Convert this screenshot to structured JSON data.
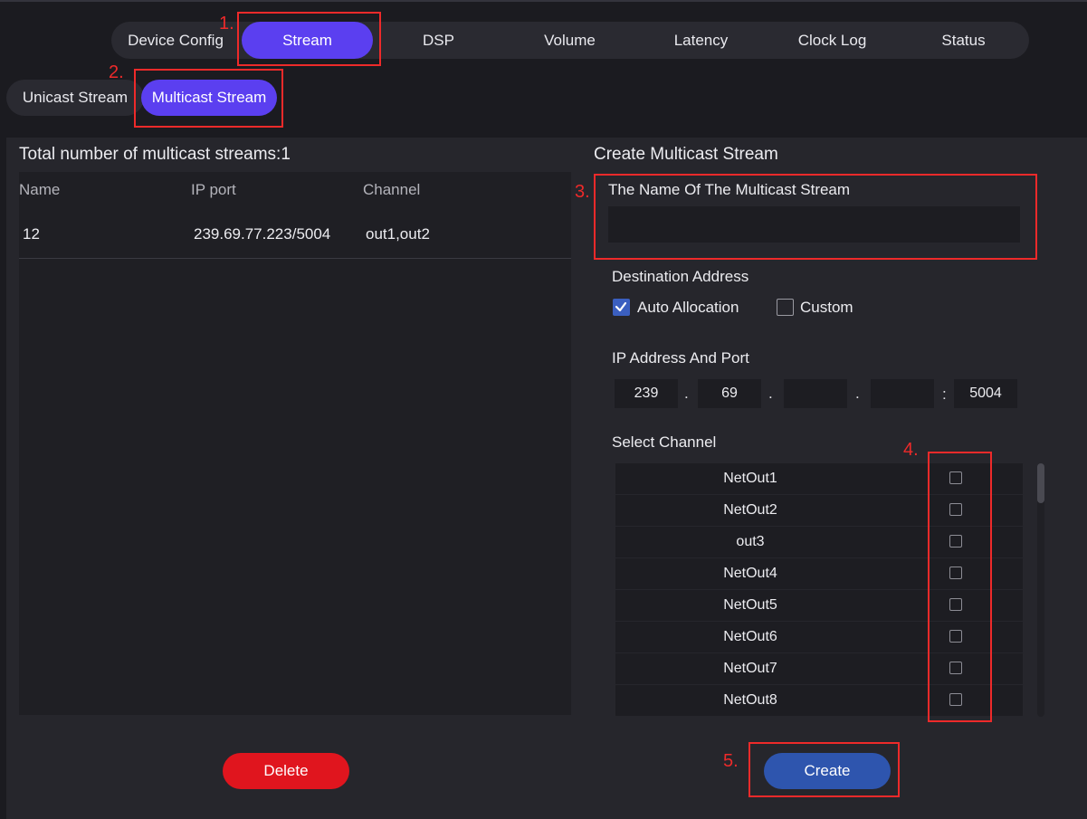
{
  "main_tabs": [
    {
      "label": "Device Config",
      "active": false
    },
    {
      "label": "Stream",
      "active": true
    },
    {
      "label": "DSP",
      "active": false
    },
    {
      "label": "Volume",
      "active": false
    },
    {
      "label": "Latency",
      "active": false
    },
    {
      "label": "Clock Log",
      "active": false
    },
    {
      "label": "Status",
      "active": false
    }
  ],
  "sub_tabs": [
    {
      "label": "Unicast Stream",
      "active": false
    },
    {
      "label": "Multicast Stream",
      "active": true
    }
  ],
  "stream_list": {
    "title": "Total number of multicast streams:1",
    "columns": [
      "Name",
      "IP port",
      "Channel"
    ],
    "rows": [
      {
        "name": "12",
        "ip_port": "239.69.77.223/5004",
        "channel": "out1,out2"
      }
    ],
    "delete_label": "Delete"
  },
  "create_form": {
    "title": "Create Multicast Stream",
    "name_label": "The Name Of The Multicast Stream",
    "name_value": "",
    "destination_label": "Destination Address",
    "auto_allocation_label": "Auto Allocation",
    "auto_allocation_checked": true,
    "custom_label": "Custom",
    "custom_checked": false,
    "ip_label": "IP Address And Port",
    "ip_octets": [
      "239",
      "69",
      "",
      ""
    ],
    "port": "5004",
    "ip_dot": ".",
    "port_sep": ":",
    "channel_label": "Select Channel",
    "channels": [
      {
        "name": "NetOut1",
        "checked": false
      },
      {
        "name": "NetOut2",
        "checked": false
      },
      {
        "name": "out3",
        "checked": false
      },
      {
        "name": "NetOut4",
        "checked": false
      },
      {
        "name": "NetOut5",
        "checked": false
      },
      {
        "name": "NetOut6",
        "checked": false
      },
      {
        "name": "NetOut7",
        "checked": false
      },
      {
        "name": "NetOut8",
        "checked": false
      }
    ],
    "create_label": "Create"
  },
  "annotations": [
    "1.",
    "2.",
    "3.",
    "4.",
    "5."
  ],
  "colors": {
    "accent_purple": "#5b3ff0",
    "delete_red": "#e0151e",
    "create_blue": "#2e55ae",
    "annotation_red": "#ee2a2a",
    "checkbox_blue": "#3b5fc0"
  }
}
